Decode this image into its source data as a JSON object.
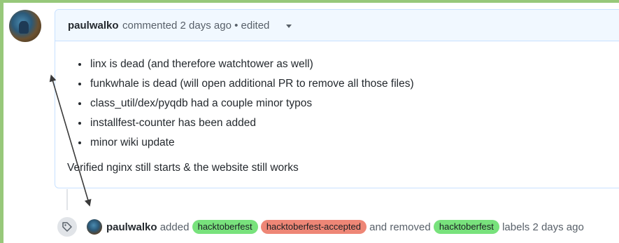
{
  "comment": {
    "author": "paulwalko",
    "meta": "commented 2 days ago • edited",
    "bullets": [
      "linx is dead (and therefore watchtower as well)",
      "funkwhale is dead (will open additional PR to remove all those files)",
      "class_util/dex/pyqdb had a couple minor typos",
      "installfest-counter has been added",
      "minor wiki update"
    ],
    "closing": "Verified nginx still starts & the website still works"
  },
  "event": {
    "author": "paulwalko",
    "added_word": "added",
    "added_labels": [
      {
        "text": "hacktoberfest",
        "color": "#78e27c"
      },
      {
        "text": "hacktoberfest-accepted",
        "color": "#ee8676"
      }
    ],
    "removed_word": "and removed",
    "removed_labels": [
      {
        "text": "hacktoberfest",
        "color": "#78e27c"
      }
    ],
    "suffix": "labels 2 days ago"
  },
  "icons": {
    "avatar": "user-avatar",
    "caret": "chevron-down-icon",
    "tag": "tag-icon"
  }
}
